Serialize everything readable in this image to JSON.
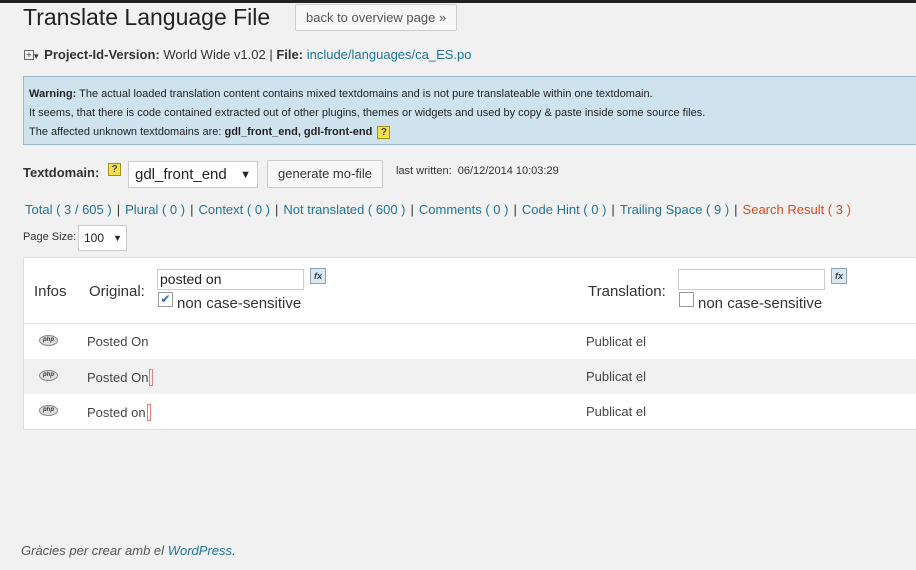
{
  "page": {
    "title": "Translate Language File",
    "back_button": "back to overview page »"
  },
  "meta": {
    "expand": "+",
    "project_label": "Project-Id-Version:",
    "project_value": "World Wide v1.02",
    "separator": "|",
    "file_label": "File:",
    "file_path": "include/languages/ca_ES.po"
  },
  "warning": {
    "label": "Warning:",
    "line1": "The actual loaded translation content contains mixed textdomains and is not pure translateable within one textdomain.",
    "line2": "It seems, that there is code contained extracted out of other plugins, themes or widgets and used by copy & paste inside some source files.",
    "line3_prefix": "The affected unknown textdomains are:",
    "line3_domains": "gdl_front_end, gdl-front-end",
    "help": "?"
  },
  "textdomain": {
    "label": "Textdomain:",
    "help": "?",
    "selected": "gdl_front_end",
    "generate_button": "generate mo-file",
    "last_written_label": "last written:",
    "last_written_value": "06/12/2014 10:03:29"
  },
  "filters": [
    {
      "label": "Total ( 3 / 605 )"
    },
    {
      "label": "Plural ( 0 )"
    },
    {
      "label": "Context ( 0 )"
    },
    {
      "label": "Not translated ( 600 )"
    },
    {
      "label": "Comments ( 0 )"
    },
    {
      "label": "Code Hint ( 0 )"
    },
    {
      "label": "Trailing Space ( 9 )"
    },
    {
      "label": "Search Result ( 3 )"
    }
  ],
  "pagesize": {
    "label": "Page Size:",
    "value": "100"
  },
  "table": {
    "col_infos": "Infos",
    "col_original": "Original:",
    "col_translation": "Translation:",
    "original_search": "posted on",
    "translation_search": "",
    "fx": "fx",
    "case_label": "non case-sensitive",
    "original_case_checked": true,
    "translation_case_checked": false,
    "php_badge": "php",
    "rows": [
      {
        "original": "Posted On",
        "translation": "Publicat el",
        "trailing": false
      },
      {
        "original": "Posted On",
        "translation": "Publicat el",
        "trailing": true
      },
      {
        "original": "Posted on",
        "translation": "Publicat el",
        "trailing": true
      }
    ]
  },
  "footer": {
    "text": "Gràcies per crear amb el",
    "link": "WordPress",
    "end": "."
  },
  "colors": {
    "link": "#21759b",
    "active_filter": "#d54e21",
    "warning_bg": "#cfe3ef"
  }
}
